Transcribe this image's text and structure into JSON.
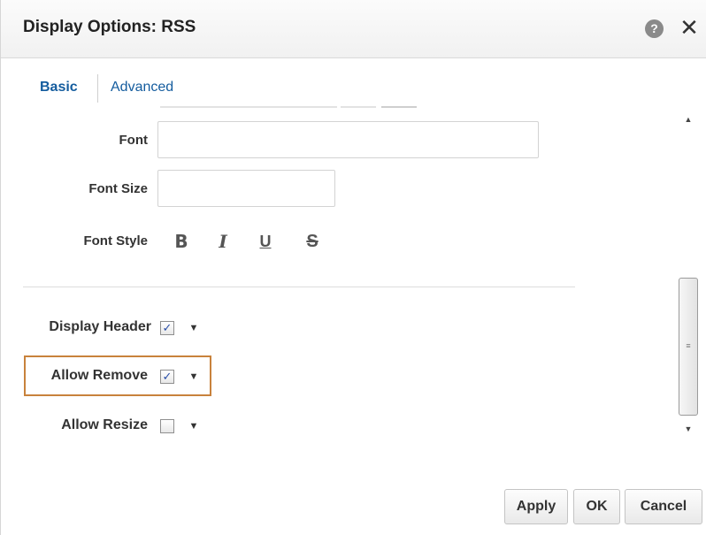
{
  "dialog": {
    "title": "Display Options: RSS",
    "help_icon": "help-icon",
    "help_glyph": "?",
    "close_icon": "close-icon",
    "close_glyph": "✕"
  },
  "tabs": [
    {
      "label": "Basic",
      "active": true
    },
    {
      "label": "Advanced",
      "active": false
    }
  ],
  "form": {
    "font_label": "Font",
    "font_value": "",
    "font_size_label": "Font Size",
    "font_size_value": "",
    "font_style_label": "Font Style",
    "style_buttons": {
      "bold": "B",
      "italic": "I",
      "underline": "U",
      "strikethrough": "S"
    }
  },
  "options": [
    {
      "label": "Display Header",
      "checked": true
    },
    {
      "label": "Allow Remove",
      "checked": true,
      "highlighted": true
    },
    {
      "label": "Allow Resize",
      "checked": false
    }
  ],
  "checkbox_glyph": "✓",
  "caret_glyph": "▼",
  "scroll": {
    "up_glyph": "▲",
    "down_glyph": "▼",
    "grip_glyph": "≡"
  },
  "buttons": {
    "apply": "Apply",
    "ok": "OK",
    "cancel": "Cancel"
  },
  "colors": {
    "tab_link": "#145c9e",
    "highlight_border": "#c8823c",
    "check_mark": "#2a4ea8"
  }
}
